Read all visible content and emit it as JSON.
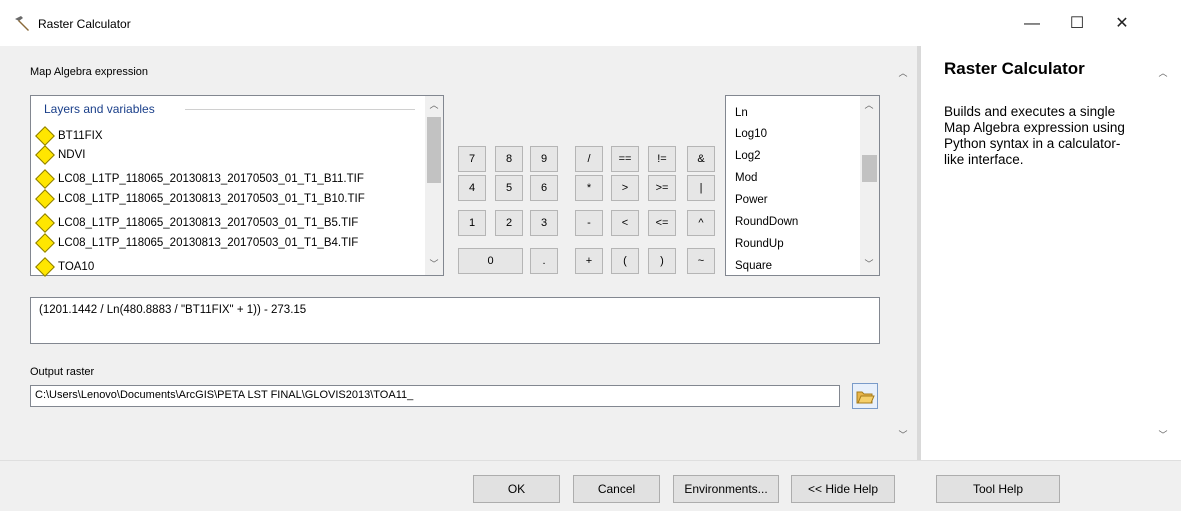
{
  "window": {
    "title": "Raster Calculator",
    "controls": {
      "minimize": "—",
      "maximize": "☐",
      "close": "✕"
    }
  },
  "main": {
    "map_algebra_label": "Map Algebra expression",
    "layers_header": "Layers and variables",
    "layers": [
      "BT11FIX",
      "NDVI",
      "LC08_L1TP_118065_20130813_20170503_01_T1_B11.TIF",
      "LC08_L1TP_118065_20130813_20170503_01_T1_B10.TIF",
      "LC08_L1TP_118065_20130813_20170503_01_T1_B5.TIF",
      "LC08_L1TP_118065_20130813_20170503_01_T1_B4.TIF",
      "TOA10"
    ],
    "calculator_rows": [
      [
        "7",
        "8",
        "9",
        "/",
        "==",
        "!=",
        "&"
      ],
      [
        "4",
        "5",
        "6",
        "*",
        ">",
        ">=",
        "|"
      ],
      [
        "1",
        "2",
        "3",
        "-",
        "<",
        "<=",
        "^"
      ],
      [
        "0",
        ".",
        "+",
        "(",
        ")",
        "~"
      ]
    ],
    "functions": [
      "Ln",
      "Log10",
      "Log2",
      "Mod",
      "Power",
      "RoundDown",
      "RoundUp",
      "Square"
    ],
    "expression": "(1201.1442 / Ln(480.8883 / \"BT11FIX\" + 1)) - 273.15",
    "output_label": "Output raster",
    "output_value": "C:\\Users\\Lenovo\\Documents\\ArcGIS\\PETA LST FINAL\\GLOVIS2013\\TOA11_"
  },
  "help": {
    "title": "Raster Calculator",
    "body": "Builds and executes a single Map Algebra expression using Python syntax in a calculator-like interface."
  },
  "buttons": {
    "ok": "OK",
    "cancel": "Cancel",
    "environments": "Environments...",
    "hide_help": "<< Hide Help",
    "tool_help": "Tool Help"
  },
  "icons": {
    "title": "hammer-icon",
    "browse": "folder-open-icon",
    "layer": "raster-layer-diamond-icon"
  }
}
